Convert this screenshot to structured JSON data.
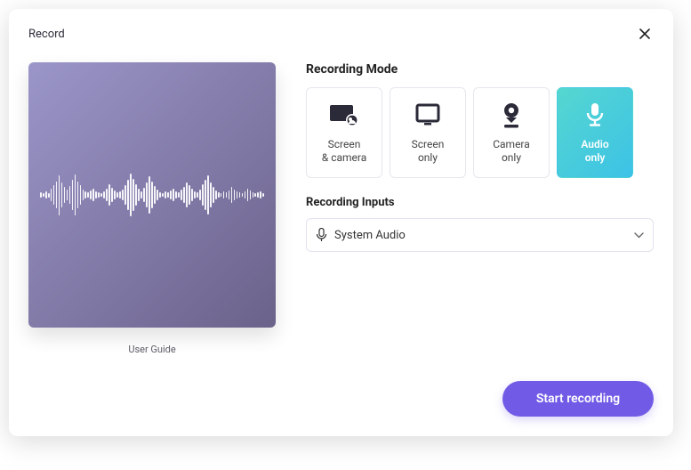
{
  "window": {
    "title": "Record"
  },
  "preview": {
    "caption": "User Guide"
  },
  "mode": {
    "heading": "Recording Mode",
    "options": [
      {
        "id": "screen-camera",
        "label": "Screen\n& camera",
        "icon": "screen-camera-icon",
        "selected": false
      },
      {
        "id": "screen-only",
        "label": "Screen\nonly",
        "icon": "screen-icon",
        "selected": false
      },
      {
        "id": "camera-only",
        "label": "Camera\nonly",
        "icon": "camera-icon",
        "selected": false
      },
      {
        "id": "audio-only",
        "label": "Audio\nonly",
        "icon": "microphone-icon",
        "selected": true
      }
    ]
  },
  "inputs": {
    "heading": "Recording Inputs",
    "selected": "System Audio"
  },
  "actions": {
    "start": "Start recording"
  },
  "colors": {
    "accent": "#715be6"
  }
}
